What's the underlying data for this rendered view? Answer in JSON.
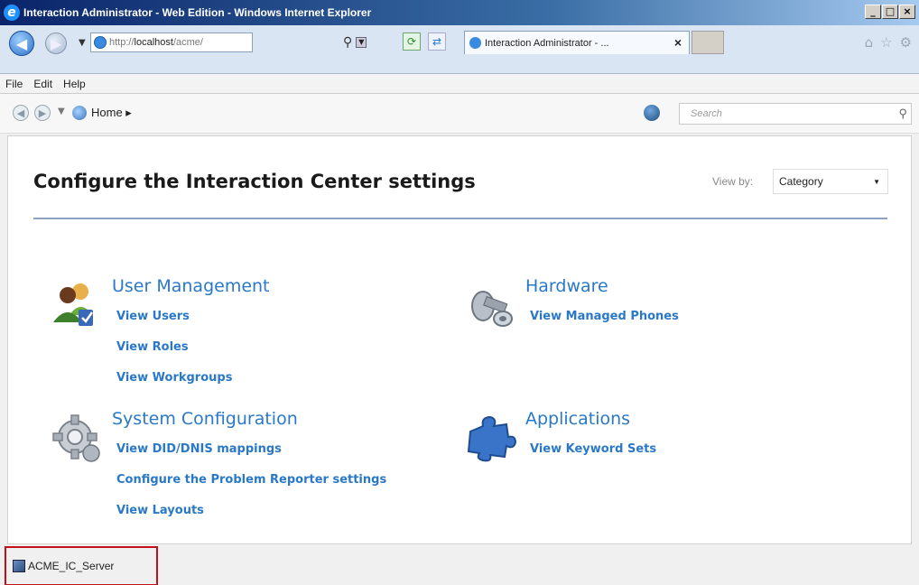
{
  "window": {
    "title": "Interaction Administrator - Web Edition - Windows Internet Explorer",
    "controls": [
      "_",
      "□",
      "×"
    ]
  },
  "browser": {
    "url_prefix": "http://",
    "url_host": "localhost",
    "url_path": "/acme/",
    "tab_title": "Interaction Administrator - ...",
    "tab_close": "×"
  },
  "menu": [
    "File",
    "Edit",
    "Help"
  ],
  "breadcrumb": {
    "home_label": "Home ▸"
  },
  "search": {
    "placeholder": "Search"
  },
  "page": {
    "title": "Configure the Interaction Center settings",
    "view_by_label": "View by:",
    "view_by_value": "Category"
  },
  "categories": {
    "user_management": {
      "title": "User Management",
      "icon": "users-icon",
      "links": [
        "View Users",
        "View Roles",
        "View Workgroups"
      ]
    },
    "hardware": {
      "title": "Hardware",
      "icon": "hardware-icon",
      "links": [
        "View Managed Phones"
      ]
    },
    "system_configuration": {
      "title": "System Configuration",
      "icon": "gear-icon",
      "links": [
        "View DID/DNIS mappings",
        "Configure the Problem Reporter settings",
        "View Layouts"
      ]
    },
    "applications": {
      "title": "Applications",
      "icon": "puzzle-icon",
      "links": [
        "View Keyword Sets"
      ]
    }
  },
  "status": {
    "server": "ACME_IC_Server"
  },
  "colors": {
    "link": "#2a78c8",
    "rule": "#8da2bf",
    "highlight": "#c0121a"
  }
}
